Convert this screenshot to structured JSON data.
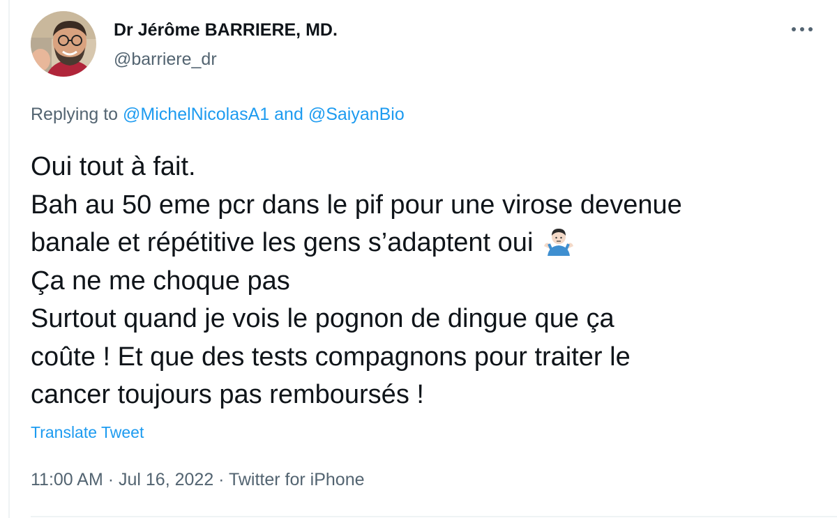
{
  "author": {
    "display_name": "Dr Jérôme BARRIERE, MD.",
    "handle": "@barriere_dr",
    "avatar_icon": "profile-photo"
  },
  "more_icon": "more-options-icon",
  "reply_context": {
    "prefix": "Replying to ",
    "mentions": [
      "@MichelNicolasA1",
      "@SaiyanBio"
    ],
    "joiner": " and "
  },
  "tweet": {
    "lines": [
      "Oui tout à fait.",
      "Bah au 50 eme pcr dans le pif pour une virose devenue",
      "banale et répétitive les gens s’adaptent oui",
      "Ça ne me choque pas",
      "Surtout quand je vois le pognon de dingue que ça",
      "coûte ! Et que des tests compagnons pour traiter le",
      "cancer toujours pas remboursés !"
    ],
    "emoji_icon": "person-shrugging-emoji"
  },
  "translate_label": "Translate Tweet",
  "meta": {
    "time": "11:00 AM",
    "separator": " · ",
    "date": "Jul 16, 2022",
    "source": "Twitter for iPhone"
  },
  "colors": {
    "text_primary": "#0f1419",
    "text_secondary": "#536471",
    "link": "#1d9bf0",
    "divider": "#eff3f4"
  }
}
